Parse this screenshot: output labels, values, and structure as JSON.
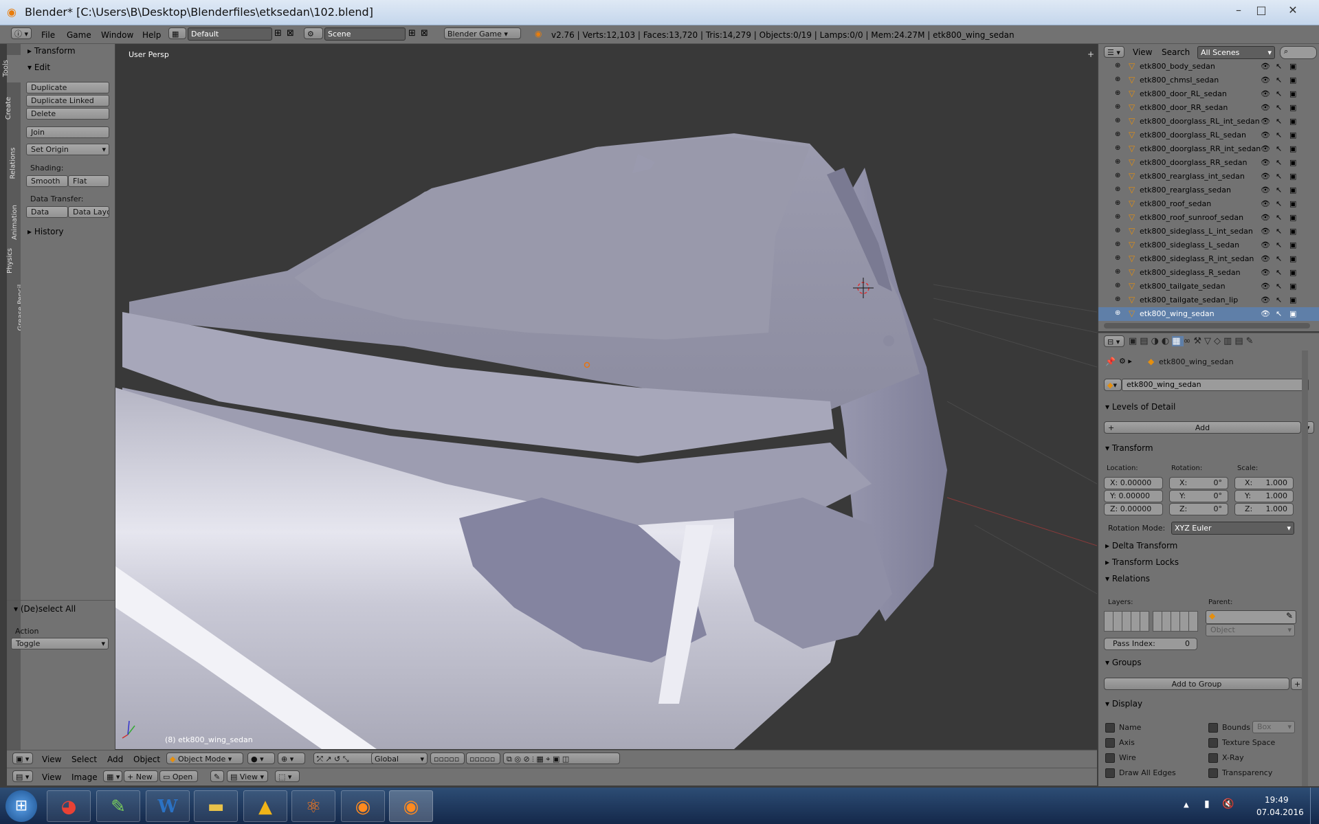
{
  "window": {
    "title": "Blender* [C:\\Users\\B\\Desktop\\Blenderfiles\\etksedan\\102.blend]",
    "controls": {
      "minimize": "–",
      "maximize": "□",
      "close": "✕"
    }
  },
  "info_header": {
    "menus": [
      "File",
      "Game",
      "Window",
      "Help"
    ],
    "screen_layout": "Default",
    "scene": "Scene",
    "engine": "Blender Game",
    "stats": "v2.76 | Verts:12,103 | Faces:13,720 | Tris:14,279 | Objects:0/19 | Lamps:0/0 | Mem:24.27M | etk800_wing_sedan"
  },
  "tool_tabs": [
    "Tools",
    "Create",
    "Relations",
    "Animation",
    "Physics",
    "Grease Pencil"
  ],
  "tool_shelf": {
    "transform_panel": "Transform",
    "edit_panel": "Edit",
    "buttons": {
      "duplicate": "Duplicate",
      "duplicate_linked": "Duplicate Linked",
      "delete": "Delete",
      "join": "Join",
      "set_origin": "Set Origin"
    },
    "shading_label": "Shading:",
    "smooth": "Smooth",
    "flat": "Flat",
    "data_transfer_label": "Data Transfer:",
    "data": "Data",
    "data_layout": "Data Layo",
    "history_panel": "History",
    "operator_panel": "(De)select All",
    "action_label": "Action",
    "action_value": "Toggle"
  },
  "viewport": {
    "view_name": "User Persp",
    "active_object_label": "(8) etk800_wing_sedan"
  },
  "viewport_header": {
    "menus": [
      "View",
      "Select",
      "Add",
      "Object"
    ],
    "mode": "Object Mode",
    "orientation": "Global"
  },
  "image_header": {
    "menus": [
      "View",
      "Image"
    ],
    "new": "New",
    "open": "Open",
    "view": "View"
  },
  "outliner": {
    "header": {
      "view": "View",
      "search": "Search",
      "scenes": "All Scenes"
    },
    "items": [
      "etk800_body_sedan",
      "etk800_chmsl_sedan",
      "etk800_door_RL_sedan",
      "etk800_door_RR_sedan",
      "etk800_doorglass_RL_int_sedan",
      "etk800_doorglass_RL_sedan",
      "etk800_doorglass_RR_int_sedan",
      "etk800_doorglass_RR_sedan",
      "etk800_rearglass_int_sedan",
      "etk800_rearglass_sedan",
      "etk800_roof_sedan",
      "etk800_roof_sunroof_sedan",
      "etk800_sideglass_L_int_sedan",
      "etk800_sideglass_L_sedan",
      "etk800_sideglass_R_int_sedan",
      "etk800_sideglass_R_sedan",
      "etk800_tailgate_sedan",
      "etk800_tailgate_sedan_lip",
      "etk800_wing_sedan"
    ]
  },
  "properties": {
    "breadcrumb": "etk800_wing_sedan",
    "object_name": "etk800_wing_sedan",
    "lod_panel": "Levels of Detail",
    "add": "Add",
    "transform_panel": "Transform",
    "location_label": "Location:",
    "rotation_label": "Rotation:",
    "scale_label": "Scale:",
    "location": [
      "X: 0.00000",
      "Y: 0.00000",
      "Z: 0.00000"
    ],
    "rotation_axes": [
      "X:",
      "Y:",
      "Z:"
    ],
    "rotation_values": [
      "0°",
      "0°",
      "0°"
    ],
    "scale_axes": [
      "X:",
      "Y:",
      "Z:"
    ],
    "scale_values": [
      "1.000",
      "1.000",
      "1.000"
    ],
    "rotation_mode_label": "Rotation Mode:",
    "rotation_mode": "XYZ Euler",
    "delta_transform": "Delta Transform",
    "transform_locks": "Transform Locks",
    "relations_panel": "Relations",
    "layers_label": "Layers:",
    "parent_label": "Parent:",
    "parent_type": "Object",
    "pass_index_label": "Pass Index:",
    "pass_index": "0",
    "groups_panel": "Groups",
    "add_to_group": "Add to Group",
    "display_panel": "Display",
    "display_name": "Name",
    "display_axis": "Axis",
    "display_wire": "Wire",
    "display_all_edges": "Draw All Edges",
    "display_bounds": "Bounds",
    "bounds_type": "Box",
    "display_texture_space": "Texture Space",
    "display_xray": "X-Ray",
    "display_transparency": "Transparency"
  },
  "taskbar": {
    "time": "19:49",
    "date": "07.04.2016"
  }
}
